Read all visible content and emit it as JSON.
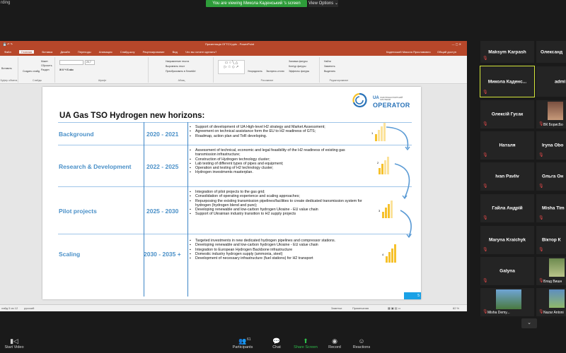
{
  "zoom": {
    "recording_label": "rding",
    "viewing_banner": "You are viewing Микола Каденський 's screen",
    "view_options": "View Options",
    "toolbar": {
      "start_video": "Start Video",
      "participants": "Participants",
      "participants_count": "61",
      "chat": "Chat",
      "share_screen": "Share Screen",
      "record": "Record",
      "reactions": "Reactions"
    }
  },
  "ppt": {
    "title": "Презентація ОГТСУ.pptx - PowerPoint",
    "user": "Каденський Микола Ярославович",
    "share": "Общий доступ",
    "menu": [
      "Файл",
      "Главная",
      "Вставка",
      "Дизайн",
      "Переходы",
      "Анимация",
      "Слайд-шоу",
      "Рецензирование",
      "Вид",
      "Что вы хотите сделать?"
    ],
    "ribbon_groups": [
      "Буфер обмена",
      "Слайды",
      "Шрифт",
      "Абзац",
      "Рисование",
      "Редактирование"
    ],
    "ribbon_texts": {
      "create_slide": "Создать слайд",
      "layout": "Макет",
      "reset": "Сбросить",
      "section": "Раздел",
      "paste": "Вставить",
      "text_direction": "Направление текста",
      "align_text": "Выровнять текст",
      "smartart": "Преобразовать в SmartArt",
      "arrange": "Упорядочить",
      "quick_styles": "Экспресс-стили",
      "shape_fill": "Заливка фигуры",
      "shape_outline": "Контур фигуры",
      "shape_effects": "Эффекты фигуры",
      "find": "Найти",
      "replace": "Заменить",
      "select": "Выделить"
    },
    "font_size": "20,7",
    "status": {
      "slide": "лайд 5 из 12",
      "language": "русский",
      "notes": "Заметки",
      "comments": "Примечания",
      "zoom": "82 %"
    }
  },
  "slide": {
    "title": "UA Gas TSO Hydrogen new horizons:",
    "logo_ua": "UA",
    "logo_small": "ГАЗОТРАНСПОРТНИЙ СИСТЕМИ",
    "logo_operator": "OPERATOR",
    "page_number": "5",
    "rows": [
      {
        "name": "Background",
        "years": "2020 - 2021",
        "bullets": [
          "Support of development of UA High-level H2 strategy and  Market Assessment;",
          "Agreement on technical assistance form the EU to H2 readiness of GTS;",
          "Roadmap, action plan and ToR developing."
        ]
      },
      {
        "name": "Research & Development",
        "years": "2022 - 2025",
        "bullets": [
          "Assessment of technical, economic and legal feasibility of the H2 readiness of existing gas transmission infrastructure;",
          "Construction of Hydrogen technology cluster;",
          "Lab testing of different types of pipes and equipment;",
          "Operation and testing of H2 technology cluster;",
          "Hydrogen investments masterplan."
        ]
      },
      {
        "name": "Pilot projects",
        "years": "2025 - 2030",
        "bullets": [
          "Integration of pilot projects to the gas grid;",
          "Consolidation of operating experience and scaling approaches;",
          "Repurposing the existing transmission pipelines/facilities to create dedicated transmission system for hydrogen (hydrogen blend and pure);",
          "Developing renewable and low-carbon hydrogen Ukraine - EU value chain",
          "Support  of  Ukrainian industry transition to H2 supply projects"
        ]
      },
      {
        "name": "Scaling",
        "years": "2030 - 2035 +",
        "bullets": [
          "Targeted investments in new dedicated hydrogen pipelines and compressor stations.",
          "Developing renewable and low-carbon hydrogen Ukraine - EU value chain",
          "Integration to European Hydrogen Backbone infrastructure",
          "Domestic industry hydrogen supply (ammonia, steel)",
          "Development of necessary infrastructure (fuel stations)  for H2 transport"
        ]
      }
    ],
    "bar_icon_numbers": [
      "1",
      "2",
      "3",
      "4"
    ],
    "colors": {
      "accent_blue": "#4a90c8",
      "bar_yellow": "#f6c12c",
      "arrow_blue": "#5b9bd5"
    }
  },
  "participants": [
    {
      "name": "Maksym Karpash",
      "muted": true
    },
    {
      "name": "Олександ",
      "muted": false
    },
    {
      "name": "Микола  Каденс...",
      "muted": true,
      "active": true
    },
    {
      "name": "admi",
      "muted": false
    },
    {
      "name": "Олексій Гусак",
      "muted": true
    },
    {
      "name": "ВК БорисБо",
      "muted": true,
      "photo": true
    },
    {
      "name": "Наталя",
      "muted": true
    },
    {
      "name": "Iryna Obo",
      "muted": true
    },
    {
      "name": "Ivan Pavliv",
      "muted": true
    },
    {
      "name": "Ольга Он",
      "muted": true
    },
    {
      "name": "Гайла Андрій",
      "muted": true
    },
    {
      "name": "Misha Tim",
      "muted": true
    },
    {
      "name": "Maryna Kraichyk",
      "muted": true
    },
    {
      "name": "Віктор К",
      "muted": true
    },
    {
      "name": "Galyna",
      "muted": true
    },
    {
      "name": "Влад Вишн",
      "muted": true,
      "photo": true
    },
    {
      "name": "Misha Demy...",
      "muted": true,
      "photo": true
    },
    {
      "name": "Nazar Antoni",
      "muted": true,
      "photo": true
    }
  ]
}
